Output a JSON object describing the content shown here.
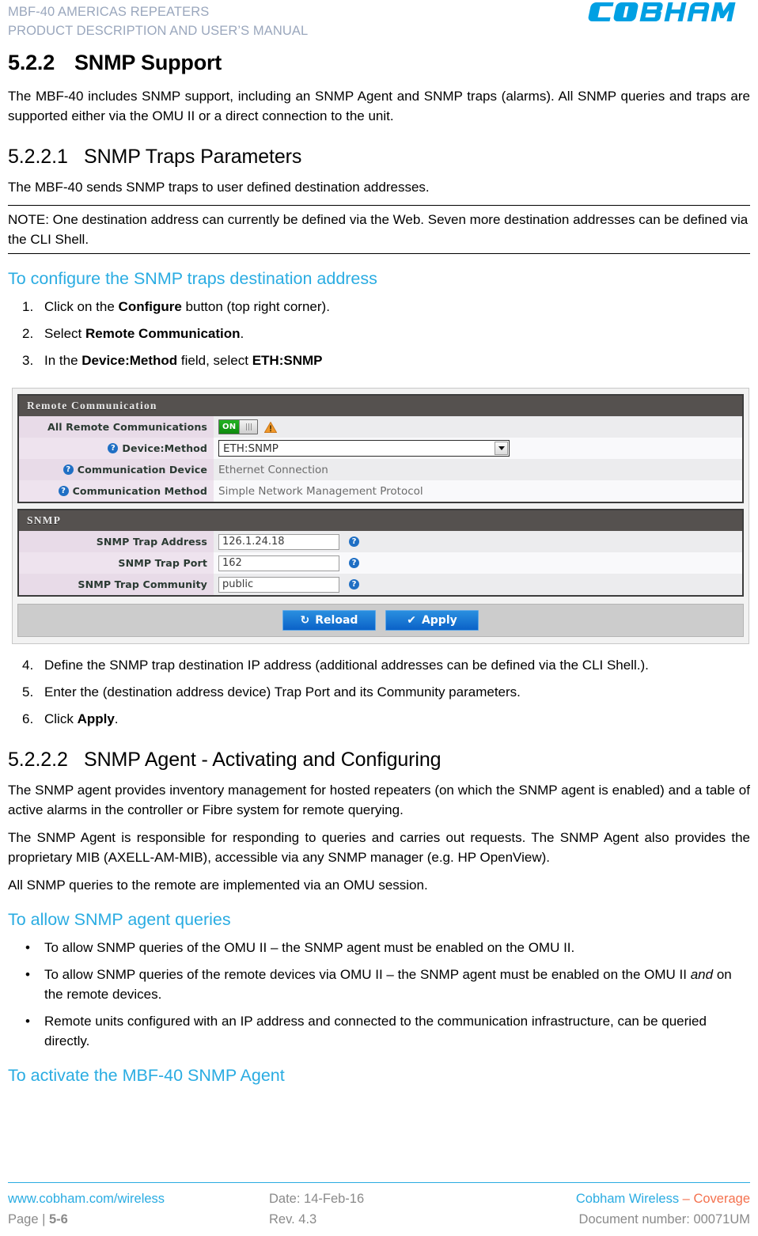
{
  "header": {
    "line1": "MBF-40 AMERICAS REPEATERS",
    "line2": "PRODUCT DESCRIPTION AND USER’S MANUAL",
    "logo_text": "COBHAM",
    "logo_color": "#00a0e3"
  },
  "sections": {
    "h1_number": "5.2.2",
    "h1_title": "SNMP Support",
    "intro": "The MBF-40 includes SNMP support, including an SNMP Agent and SNMP traps (alarms). All SNMP queries and traps are supported either via the OMU II or a direct connection to the unit.",
    "h2a_number": "5.2.2.1",
    "h2a_title": "SNMP Traps Parameters",
    "para_traps": "The MBF-40 sends SNMP traps to user defined destination addresses.",
    "note": "NOTE: One destination address can currently be defined via the Web. Seven more destination addresses can be defined via the CLI Shell.",
    "blue_h_configure": "To configure the SNMP traps destination address",
    "steps_1_3": [
      {
        "num": "1.",
        "pre": "Click on the ",
        "bold": "Configure",
        "post": " button (top right corner)."
      },
      {
        "num": "2.",
        "pre": "Select ",
        "bold": "Remote Communication",
        "post": "."
      },
      {
        "num": "3.",
        "pre": "In the ",
        "bold": "Device:Method",
        "mid": " field, select ",
        "bold2": "ETH:SNMP",
        "post": ""
      }
    ],
    "steps_4_6": [
      {
        "num": "4.",
        "text": "Define the SNMP trap destination IP address (additional addresses can be defined via the CLI Shell.)."
      },
      {
        "num": "5.",
        "text": "Enter the (destination address device) Trap Port and its Community parameters."
      },
      {
        "num": "6.",
        "pre": "Click ",
        "bold": "Apply",
        "post": "."
      }
    ],
    "h2b_number": "5.2.2.2",
    "h2b_title": "SNMP Agent - Activating and Configuring",
    "para_agent_1": "The SNMP agent provides inventory management for hosted repeaters (on which the SNMP agent is enabled) and a table of active alarms in the controller or Fibre system for remote querying.",
    "para_agent_2": "The SNMP Agent is responsible for responding to queries and carries out requests. The SNMP Agent also provides the proprietary MIB (AXELL-AM-MIB), accessible via any SNMP manager (e.g. HP OpenView).",
    "para_agent_3": "All SNMP queries to the remote are implemented via an OMU session.",
    "blue_h_allow": "To allow SNMP agent queries",
    "bullets": [
      {
        "text": "To allow SNMP queries of the OMU II – the SNMP agent must be enabled on the OMU II."
      },
      {
        "pre": "To allow SNMP queries of the remote devices via OMU II – the SNMP agent must be enabled on the OMU II ",
        "italic": "and",
        "post": " on the remote devices."
      },
      {
        "text": "Remote units configured with an IP address and connected to the communication infrastructure, can be queried directly."
      }
    ],
    "blue_h_activate": "To activate the MBF-40 SNMP Agent"
  },
  "screenshot": {
    "panel_remote": {
      "title": "Remote Communication",
      "rows": [
        {
          "label": "All Remote Communications",
          "help": false,
          "type": "toggle",
          "toggle_state": "ON",
          "warning": true
        },
        {
          "label": "Device:Method",
          "help": true,
          "type": "select",
          "value": "ETH:SNMP"
        },
        {
          "label": "Communication Device",
          "help": true,
          "type": "text",
          "value": "Ethernet Connection"
        },
        {
          "label": "Communication Method",
          "help": true,
          "type": "text",
          "value": "Simple Network Management Protocol"
        }
      ]
    },
    "panel_snmp": {
      "title": "SNMP",
      "rows": [
        {
          "label": "SNMP Trap Address",
          "type": "input",
          "value": "126.1.24.18",
          "help_after": true
        },
        {
          "label": "SNMP Trap Port",
          "type": "input",
          "value": "162",
          "help_after": true
        },
        {
          "label": "SNMP Trap Community",
          "type": "input",
          "value": "public",
          "help_after": true
        }
      ]
    },
    "actions": {
      "reload_label": "Reload",
      "reload_icon": "refresh-icon",
      "apply_label": "Apply",
      "apply_icon": "check-icon",
      "button_color": "#1272d2"
    },
    "help_glyph": "?"
  },
  "footer": {
    "website": "www.cobham.com/wireless",
    "date": "Date: 14-Feb-16",
    "brand_blue": "Cobham Wireless",
    "brand_sep": " – ",
    "brand_orange": "Coverage",
    "page_prefix": "Page | ",
    "page_number": "5-6",
    "rev": "Rev. 4.3",
    "docnum": "Document number: 00071UM",
    "accent_blue": "#2aace2",
    "accent_orange": "#f4714e"
  }
}
